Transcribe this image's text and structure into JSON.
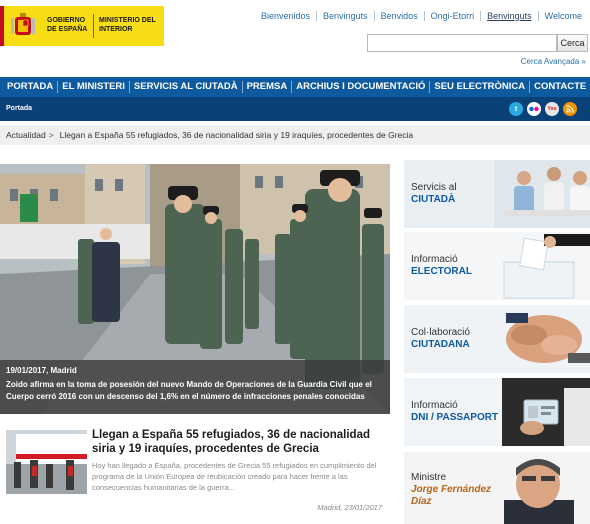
{
  "header": {
    "logo_line1": "GOBIERNO DE ESPAÑA",
    "logo_line2": "MINISTERIO DEL INTERIOR",
    "languages": [
      "Bienvenidos",
      "Benvinguts",
      "Benvidos",
      "Ongi-Etorri",
      "Benvinguts",
      "Welcome"
    ],
    "active_language_index": 4,
    "search_placeholder": "",
    "search_button": "Cerca",
    "advanced_search": "Cerca Avançada »"
  },
  "nav": {
    "items": [
      "PORTADA",
      "EL MINISTERI",
      "SERVICIS AL CIUTADÀ",
      "PREMSA",
      "ARCHIUS I DOCUMENTACIÓ",
      "SEU ELECTRÒNICA",
      "CONTACTE"
    ]
  },
  "subnav": {
    "label": "Portada",
    "social_icons": [
      "twitter-icon",
      "flickr-icon",
      "youtube-icon",
      "rss-icon"
    ]
  },
  "breadcrumb": {
    "root": "Actualidad",
    "separator": ">",
    "current": "Llegan a España 55 refugiados, 36 de nacionalidad siria y 19 iraquíes, procedentes de Grecia"
  },
  "hero": {
    "date": "19/01/2017, Madrid",
    "text": "Zoido afirma en la toma de posesión del nuevo Mando de Operaciones de la Guardia Civil que el Cuerpo cerró 2016 con un descenso del 1,6% en el número de infracciones penales conocidas"
  },
  "news": {
    "title": "Llegan a España 55 refugiados, 36 de nacionalidad siria y 19 iraquíes, procedentes de Grecia",
    "body": "Hoy han llegado a España, procedentes de Grecia 55 refugiados en cumplimiento del programa de la Unión Europea de reubicación creado para hacer frente a las consecuencias humanitarias de la guerra...",
    "date": "Madrid, 23/01/2017"
  },
  "sidebar": {
    "cards": [
      {
        "line1": "Servicis al",
        "line2": "CIUTADÀ"
      },
      {
        "line1": "Informació",
        "line2": "ELECTORAL"
      },
      {
        "line1": "Col·laboració",
        "line2": "CIUTADANA"
      },
      {
        "line1": "Informació",
        "line2": "DNI / PASSAPORT"
      }
    ],
    "minister": {
      "label": "Ministre",
      "name": "Jorge Fernández Díaz"
    }
  },
  "colors": {
    "nav_blue": "#0e5a9f",
    "subnav_blue": "#0a4176",
    "link_blue": "#2b6fa8",
    "logo_yellow": "#f7dd16",
    "minister_orange": "#b5651d"
  }
}
